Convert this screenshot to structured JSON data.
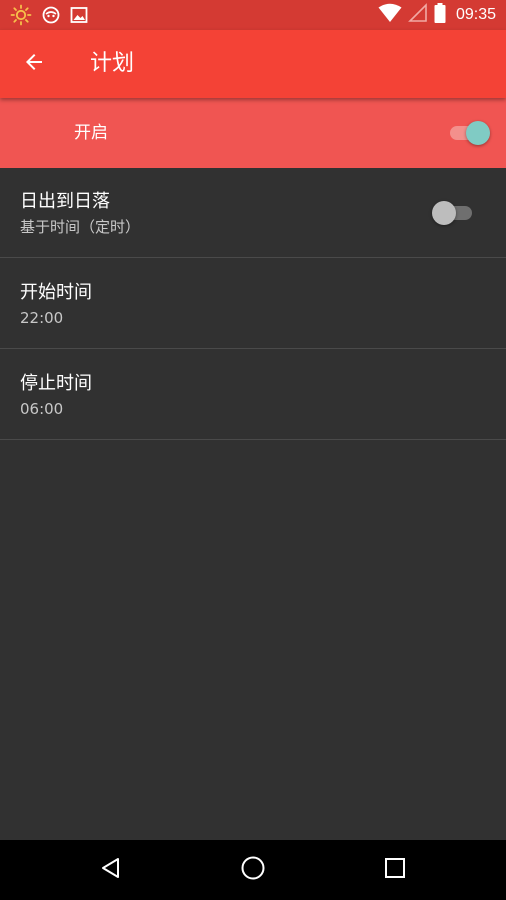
{
  "status_bar": {
    "time": "09:35",
    "left_icons": [
      "brightness-icon",
      "notification-app-icon",
      "image-icon"
    ],
    "right_icons": [
      "wifi-icon",
      "cell-signal-icon",
      "battery-icon"
    ]
  },
  "app_bar": {
    "title": "计划",
    "back_icon": "arrow-left-icon"
  },
  "master_switch": {
    "label": "开启",
    "checked": true
  },
  "settings": [
    {
      "title": "日出到日落",
      "summary": "基于时间（定时）",
      "has_toggle": true,
      "checked": false
    },
    {
      "title": "开始时间",
      "summary": "22:00"
    },
    {
      "title": "停止时间",
      "summary": "06:00"
    }
  ],
  "nav_bar": {
    "buttons": [
      "back-triangle-icon",
      "home-circle-icon",
      "recents-square-icon"
    ]
  },
  "colors": {
    "status_bar": "#d43a33",
    "app_bar": "#f44236",
    "master_row": "#f05552",
    "background": "#313131",
    "accent_thumb": "#80cbc4"
  }
}
